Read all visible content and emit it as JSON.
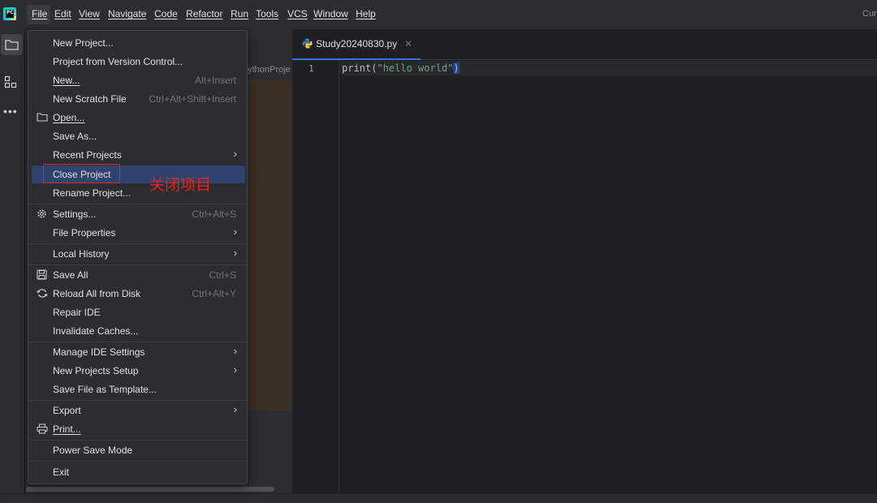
{
  "menubar": {
    "items": [
      "File",
      "Edit",
      "View",
      "Navigate",
      "Code",
      "Refactor",
      "Run",
      "Tools",
      "VCS",
      "Window",
      "Help"
    ],
    "title_clip": "Cur"
  },
  "project_panel": {
    "header_clip": "ythonProje"
  },
  "editor": {
    "tab_label": "Study20240830.py",
    "line_number": "1",
    "code": {
      "fn": "print",
      "open": "(",
      "str": "\"hello world\"",
      "close": ")"
    }
  },
  "file_menu": {
    "items": [
      {
        "label": "New Project...",
        "shortcut": ""
      },
      {
        "label": "Project from Version Control...",
        "shortcut": ""
      },
      {
        "label": "New...",
        "shortcut": "Alt+Insert"
      },
      {
        "label": "New Scratch File",
        "shortcut": "Ctrl+Alt+Shift+Insert"
      },
      {
        "label": "Open...",
        "shortcut": ""
      },
      {
        "label": "Save As...",
        "shortcut": ""
      },
      {
        "label": "Recent Projects",
        "shortcut": ""
      },
      {
        "label": "Close Project",
        "shortcut": ""
      },
      {
        "label": "Rename Project...",
        "shortcut": ""
      },
      {
        "label": "Settings...",
        "shortcut": "Ctrl+Alt+S"
      },
      {
        "label": "File Properties",
        "shortcut": ""
      },
      {
        "label": "Local History",
        "shortcut": ""
      },
      {
        "label": "Save All",
        "shortcut": "Ctrl+S"
      },
      {
        "label": "Reload All from Disk",
        "shortcut": "Ctrl+Alt+Y"
      },
      {
        "label": "Repair IDE",
        "shortcut": ""
      },
      {
        "label": "Invalidate Caches...",
        "shortcut": ""
      },
      {
        "label": "Manage IDE Settings",
        "shortcut": ""
      },
      {
        "label": "New Projects Setup",
        "shortcut": ""
      },
      {
        "label": "Save File as Template...",
        "shortcut": ""
      },
      {
        "label": "Export",
        "shortcut": ""
      },
      {
        "label": "Print...",
        "shortcut": ""
      },
      {
        "label": "Power Save Mode",
        "shortcut": ""
      },
      {
        "label": "Exit",
        "shortcut": ""
      }
    ],
    "submenu_arrow": "›",
    "selected_item": "Close Project"
  },
  "annotation": {
    "text": "关闭项目",
    "color": "#e0251b"
  },
  "colors": {
    "selection": "#2e436e",
    "accent": "#3574f0",
    "string": "#6aab73"
  }
}
